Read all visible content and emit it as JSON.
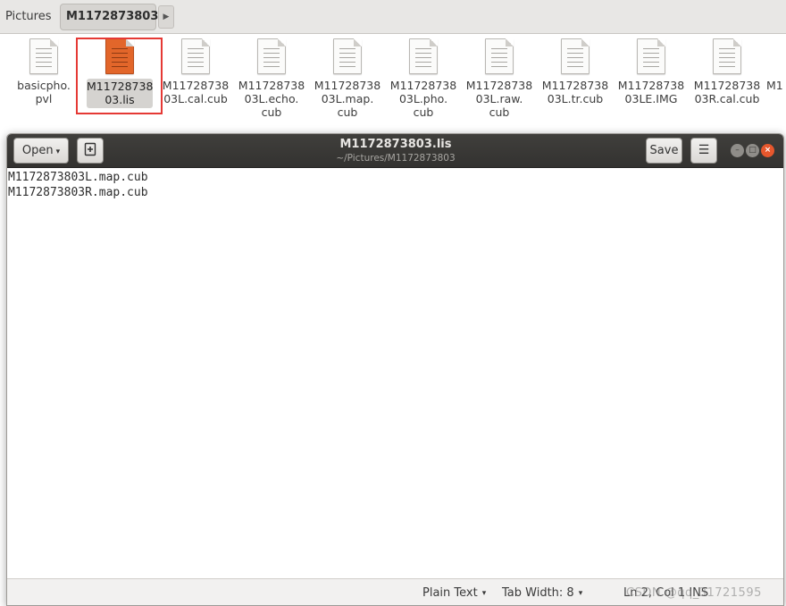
{
  "file_manager": {
    "breadcrumbs": [
      "Pictures",
      "M1172873803"
    ],
    "files": [
      {
        "line1": "basicpho.",
        "line2": "pvl",
        "line3": ""
      },
      {
        "line1": "M11728738",
        "line2": "03.lis",
        "line3": "",
        "selected": true
      },
      {
        "line1": "M11728738",
        "line2": "03L.cal.cub",
        "line3": ""
      },
      {
        "line1": "M11728738",
        "line2": "03L.echo.",
        "line3": "cub"
      },
      {
        "line1": "M11728738",
        "line2": "03L.map.",
        "line3": "cub"
      },
      {
        "line1": "M11728738",
        "line2": "03L.pho.",
        "line3": "cub"
      },
      {
        "line1": "M11728738",
        "line2": "03L.raw.",
        "line3": "cub"
      },
      {
        "line1": "M11728738",
        "line2": "03L.tr.cub",
        "line3": ""
      },
      {
        "line1": "M11728738",
        "line2": "03LE.IMG",
        "line3": ""
      },
      {
        "line1": "M11728738",
        "line2": "03R.cal.cub",
        "line3": ""
      },
      {
        "line1": "M1",
        "line2": "",
        "line3": ""
      }
    ]
  },
  "editor": {
    "open_label": "Open",
    "save_label": "Save",
    "title": "M1172873803.lis",
    "path": "~/Pictures/M1172873803",
    "lines": [
      "M1172873803L.map.cub",
      "M1172873803R.map.cub"
    ],
    "status": {
      "language": "Plain Text",
      "tab_width": "Tab Width: 8",
      "position": "Ln 2, Col 1",
      "overwrite": "INS",
      "watermark": "CSDN @qq_31721595"
    }
  },
  "colors": {
    "accent": "#e2662a",
    "highlight_box": "#e53935",
    "headerbar": "#3a3937",
    "close_button": "#e6572d"
  },
  "icons": {
    "caret": "▾",
    "forward": "▶",
    "new_document": "🖹",
    "menu": "☰",
    "minimize": "–",
    "maximize": "□",
    "close": "×"
  }
}
